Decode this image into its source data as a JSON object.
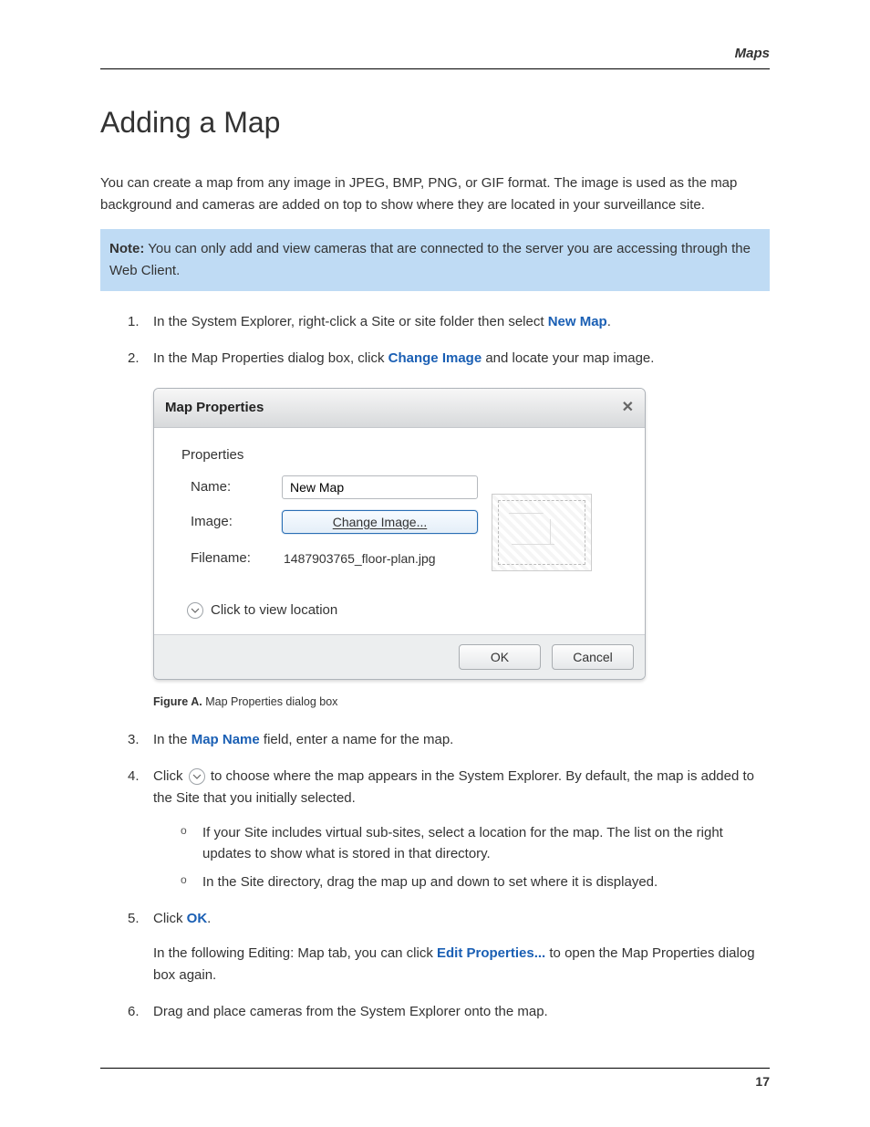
{
  "header": {
    "section": "Maps"
  },
  "title": "Adding a Map",
  "intro": "You can create a map from any image in JPEG, BMP, PNG, or GIF format. The image is used as the map background and cameras are added on top to show where they are located in your surveillance site.",
  "note": {
    "label": "Note:",
    "text": "You can only add and view cameras that are connected to the server you are accessing through the Web Client."
  },
  "steps": {
    "s1": {
      "pre": "In the System Explorer, right-click a Site or site folder then select ",
      "term": "New Map",
      "post": "."
    },
    "s2": {
      "pre": "In the Map Properties dialog box, click ",
      "term": "Change Image",
      "post": " and locate your map image."
    },
    "s3": {
      "pre": "In the ",
      "term": "Map Name",
      "post": " field, enter a name for the map."
    },
    "s4": {
      "pre": "Click ",
      "post": " to choose where the map appears in the System Explorer. By default, the map is added to the Site that you initially selected.",
      "sub": {
        "a": "If your Site includes virtual sub-sites, select a location for the map. The list on the right updates to show what is stored in that directory.",
        "b": "In the Site directory, drag the map up and down to set where it is displayed."
      }
    },
    "s5": {
      "pre": "Click ",
      "term": "OK",
      "post": ".",
      "follow_pre": "In the following Editing: Map tab, you can click ",
      "follow_term": "Edit Properties...",
      "follow_post": " to open the Map Properties dialog box again."
    },
    "s6": {
      "text": "Drag and place cameras from the System Explorer onto the map."
    }
  },
  "dialog": {
    "title": "Map Properties",
    "props_heading": "Properties",
    "name_label": "Name:",
    "name_value": "New Map",
    "image_label": "Image:",
    "change_btn": "Change Image...",
    "filename_label": "Filename:",
    "filename_value": "1487903765_floor-plan.jpg",
    "expander": "Click to view location",
    "ok": "OK",
    "cancel": "Cancel"
  },
  "figure": {
    "label": "Figure A.",
    "caption": "Map Properties dialog box"
  },
  "footer": {
    "page": "17"
  }
}
